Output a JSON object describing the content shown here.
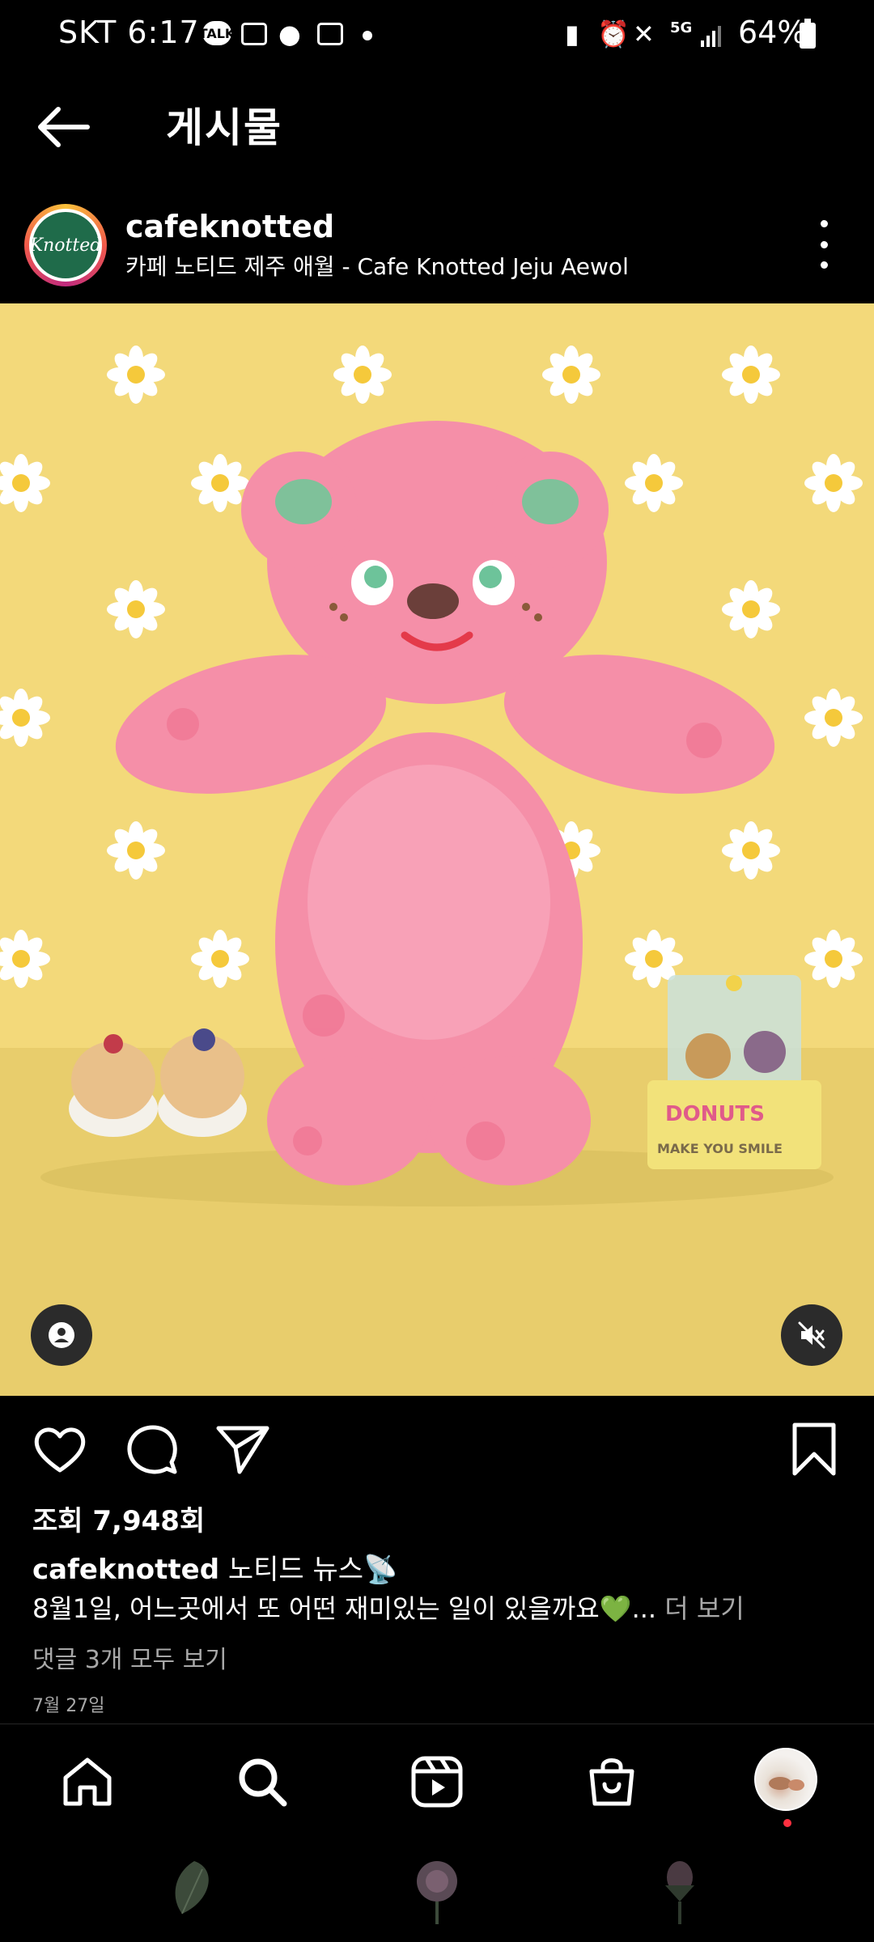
{
  "status_bar": {
    "carrier_time": "SKT 6:17",
    "talk_badge": "TALK",
    "network": "5G",
    "battery": "64%"
  },
  "header": {
    "title": "게시물"
  },
  "post": {
    "username": "cafeknotted",
    "location": "카페 노티드 제주 애월 - Cafe Knotted Jeju Aewol",
    "avatar_text": "Knotted",
    "views": "조회 7,948회",
    "caption_user": "cafeknotted",
    "caption_text": "노티드 뉴스📡",
    "caption_line2": "8월1일, 어느곳에서 또 어떤 재미있는 일이 있을까요💚...",
    "more_label": "더 보기",
    "comments_link": "댓글 3개 모두 보기",
    "date": "7월 27일"
  },
  "icons": {
    "back": "arrow-left-icon",
    "more": "more-vertical-icon",
    "like": "heart-icon",
    "comment": "comment-icon",
    "share": "send-icon",
    "save": "bookmark-icon",
    "user_tag": "user-tag-icon",
    "mute": "speaker-muted-icon",
    "home": "home-icon",
    "search": "search-icon",
    "reels": "reels-icon",
    "shop": "shop-icon"
  },
  "colors": {
    "background": "#000000",
    "media_background": "#f3d97a",
    "notification_dot": "#ff3040",
    "secondary_text": "#a8a8a8"
  }
}
